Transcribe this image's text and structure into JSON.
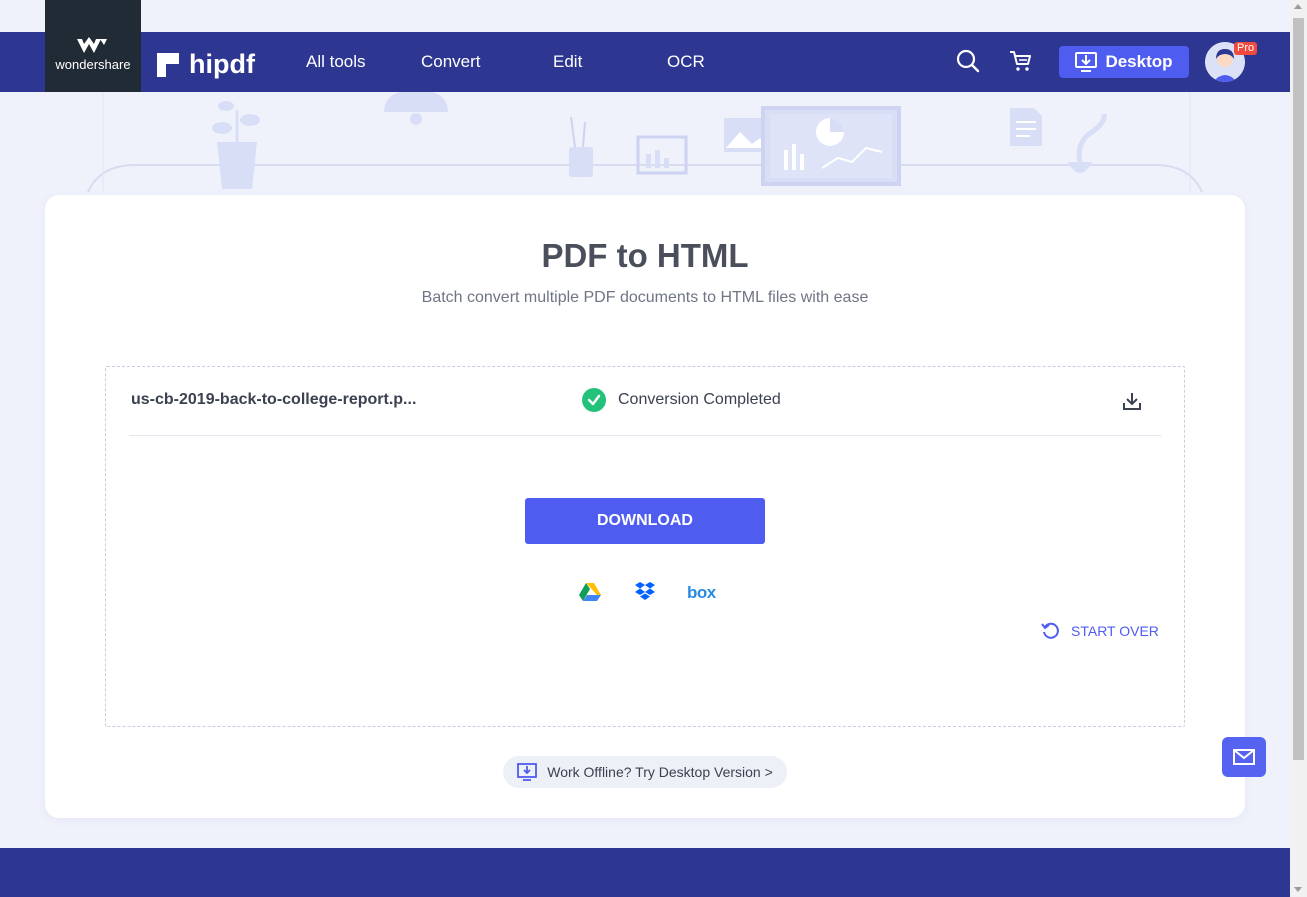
{
  "brand": {
    "company": "wondershare",
    "product": "hipdf"
  },
  "nav": {
    "items": [
      {
        "label": "All tools"
      },
      {
        "label": "Convert"
      },
      {
        "label": "Edit"
      },
      {
        "label": "OCR"
      }
    ],
    "icons": [
      "search-icon",
      "cart-icon"
    ],
    "desktop_label": "Desktop",
    "pro_badge": "Pro"
  },
  "page": {
    "title": "PDF to HTML",
    "subtitle": "Batch convert multiple PDF documents to HTML files with ease"
  },
  "file": {
    "name": "us-cb-2019-back-to-college-report.p...",
    "status": "Conversion Completed"
  },
  "actions": {
    "download_label": "DOWNLOAD",
    "cloud_services": [
      "google-drive",
      "dropbox",
      "box"
    ],
    "box_label": "box",
    "start_over_label": "START OVER"
  },
  "offline": {
    "label": "Work Offline? Try Desktop Version >"
  },
  "colors": {
    "nav_bg": "#2d3690",
    "accent": "#4f5cf0",
    "success": "#23c27a"
  }
}
